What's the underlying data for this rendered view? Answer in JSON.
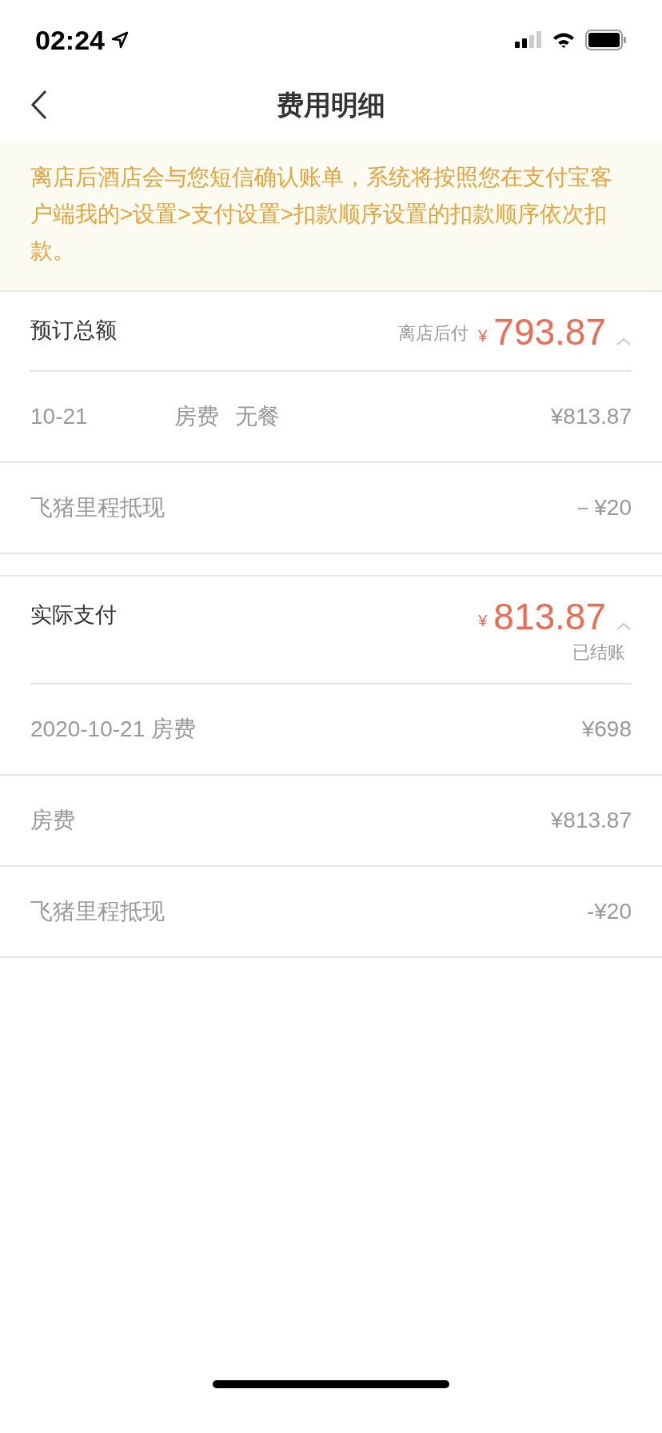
{
  "status_bar": {
    "time": "02:24"
  },
  "nav": {
    "title": "费用明细"
  },
  "notice": "离店后酒店会与您短信确认账单，系统将按照您在支付宝客户端我的>设置>支付设置>扣款顺序设置的扣款顺序依次扣款。",
  "sections": [
    {
      "title": "预订总额",
      "label": "离店后付",
      "currency": "¥",
      "amount": "793.87",
      "expanded": true,
      "rows": [
        {
          "cells": [
            "10-21",
            "房费",
            "无餐"
          ],
          "amount": "¥813.87"
        },
        {
          "cells": [
            "飞猪里程抵现"
          ],
          "amount": "－¥20"
        }
      ]
    },
    {
      "title": "实际支付",
      "currency": "¥",
      "amount": "813.87",
      "status": "已结账",
      "expanded": true,
      "rows": [
        {
          "cells": [
            "2020-10-21 房费"
          ],
          "amount": "¥698"
        },
        {
          "cells": [
            "房费"
          ],
          "amount": "¥813.87"
        },
        {
          "cells": [
            "飞猪里程抵现"
          ],
          "amount": "-¥20"
        }
      ]
    }
  ]
}
